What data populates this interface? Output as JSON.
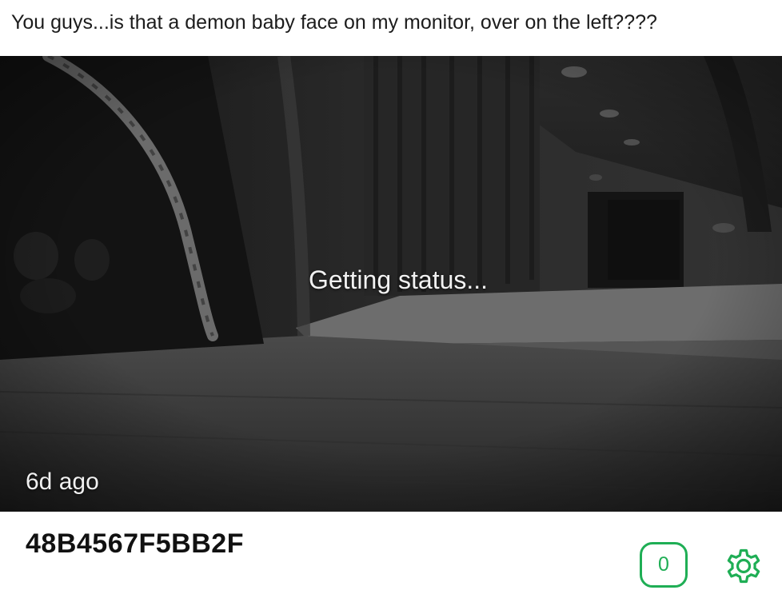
{
  "post": {
    "text": "You guys...is that a demon baby face on my monitor, over on the left????"
  },
  "camera": {
    "status_text": "Getting status...",
    "last_seen": "6d ago"
  },
  "device": {
    "id": "48B4567F5BB2F",
    "event_count": "0"
  },
  "icons": {
    "settings": "gear-icon"
  },
  "colors": {
    "accent": "#1fae55",
    "feed_background": "#1a1a1a"
  }
}
